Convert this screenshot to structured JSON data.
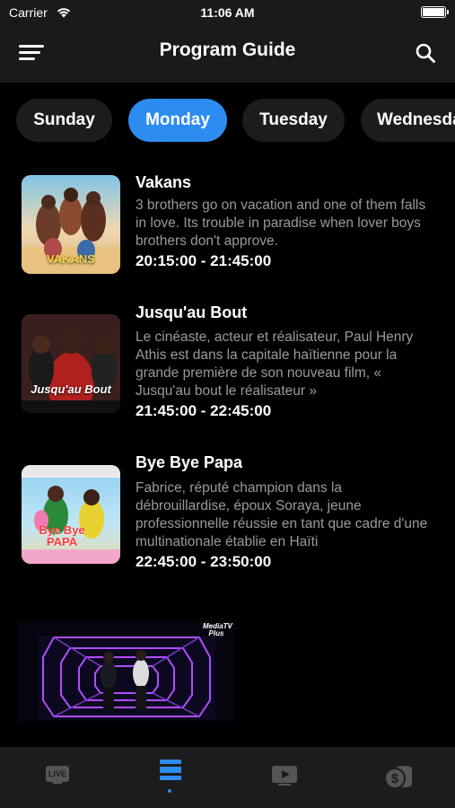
{
  "status_bar": {
    "carrier": "Carrier",
    "time": "11:06 AM"
  },
  "nav": {
    "title": "Program Guide"
  },
  "days": [
    "Sunday",
    "Monday",
    "Tuesday",
    "Wednesday"
  ],
  "selected_day": "Monday",
  "programs": [
    {
      "title": "Vakans",
      "description": "3 brothers go on vacation and one of them falls in love. Its trouble in paradise when lover boys brothers don't approve.",
      "time": "20:15:00 - 21:45:00",
      "poster_text": "VAKANS"
    },
    {
      "title": "Jusqu'au Bout",
      "description": "Le cinéaste, acteur et réalisateur, Paul Henry Athis est dans la capitale haïtienne pour la grande première de son nouveau film, « Jusqu'au bout le réalisateur »",
      "time": "21:45:00 - 22:45:00",
      "poster_text": "Jusqu'au Bout"
    },
    {
      "title": "Bye Bye Papa",
      "description": "Fabrice, réputé champion dans la débrouillardise, époux Soraya, jeune professionnelle réussie en tant que cadre d'une multinationale établie en Haïti",
      "time": "22:45:00 - 23:50:00",
      "poster_text": "Bye Bye PAPA"
    }
  ],
  "video_preview": {
    "watermark": "MediaTV Plus"
  },
  "tab_bar": {
    "items": [
      {
        "icon": "live-tv-icon",
        "label": "LIVE"
      },
      {
        "icon": "program-guide-icon"
      },
      {
        "icon": "video-play-icon"
      },
      {
        "icon": "money-coins-icon"
      }
    ],
    "active_index": 1,
    "active_color": "#2d8cf0",
    "inactive_color": "#555555"
  },
  "colors": {
    "accent": "#2d8cf0",
    "background": "#000000",
    "bar_background": "#1a1a1a",
    "description_text": "#9a9a9a"
  }
}
